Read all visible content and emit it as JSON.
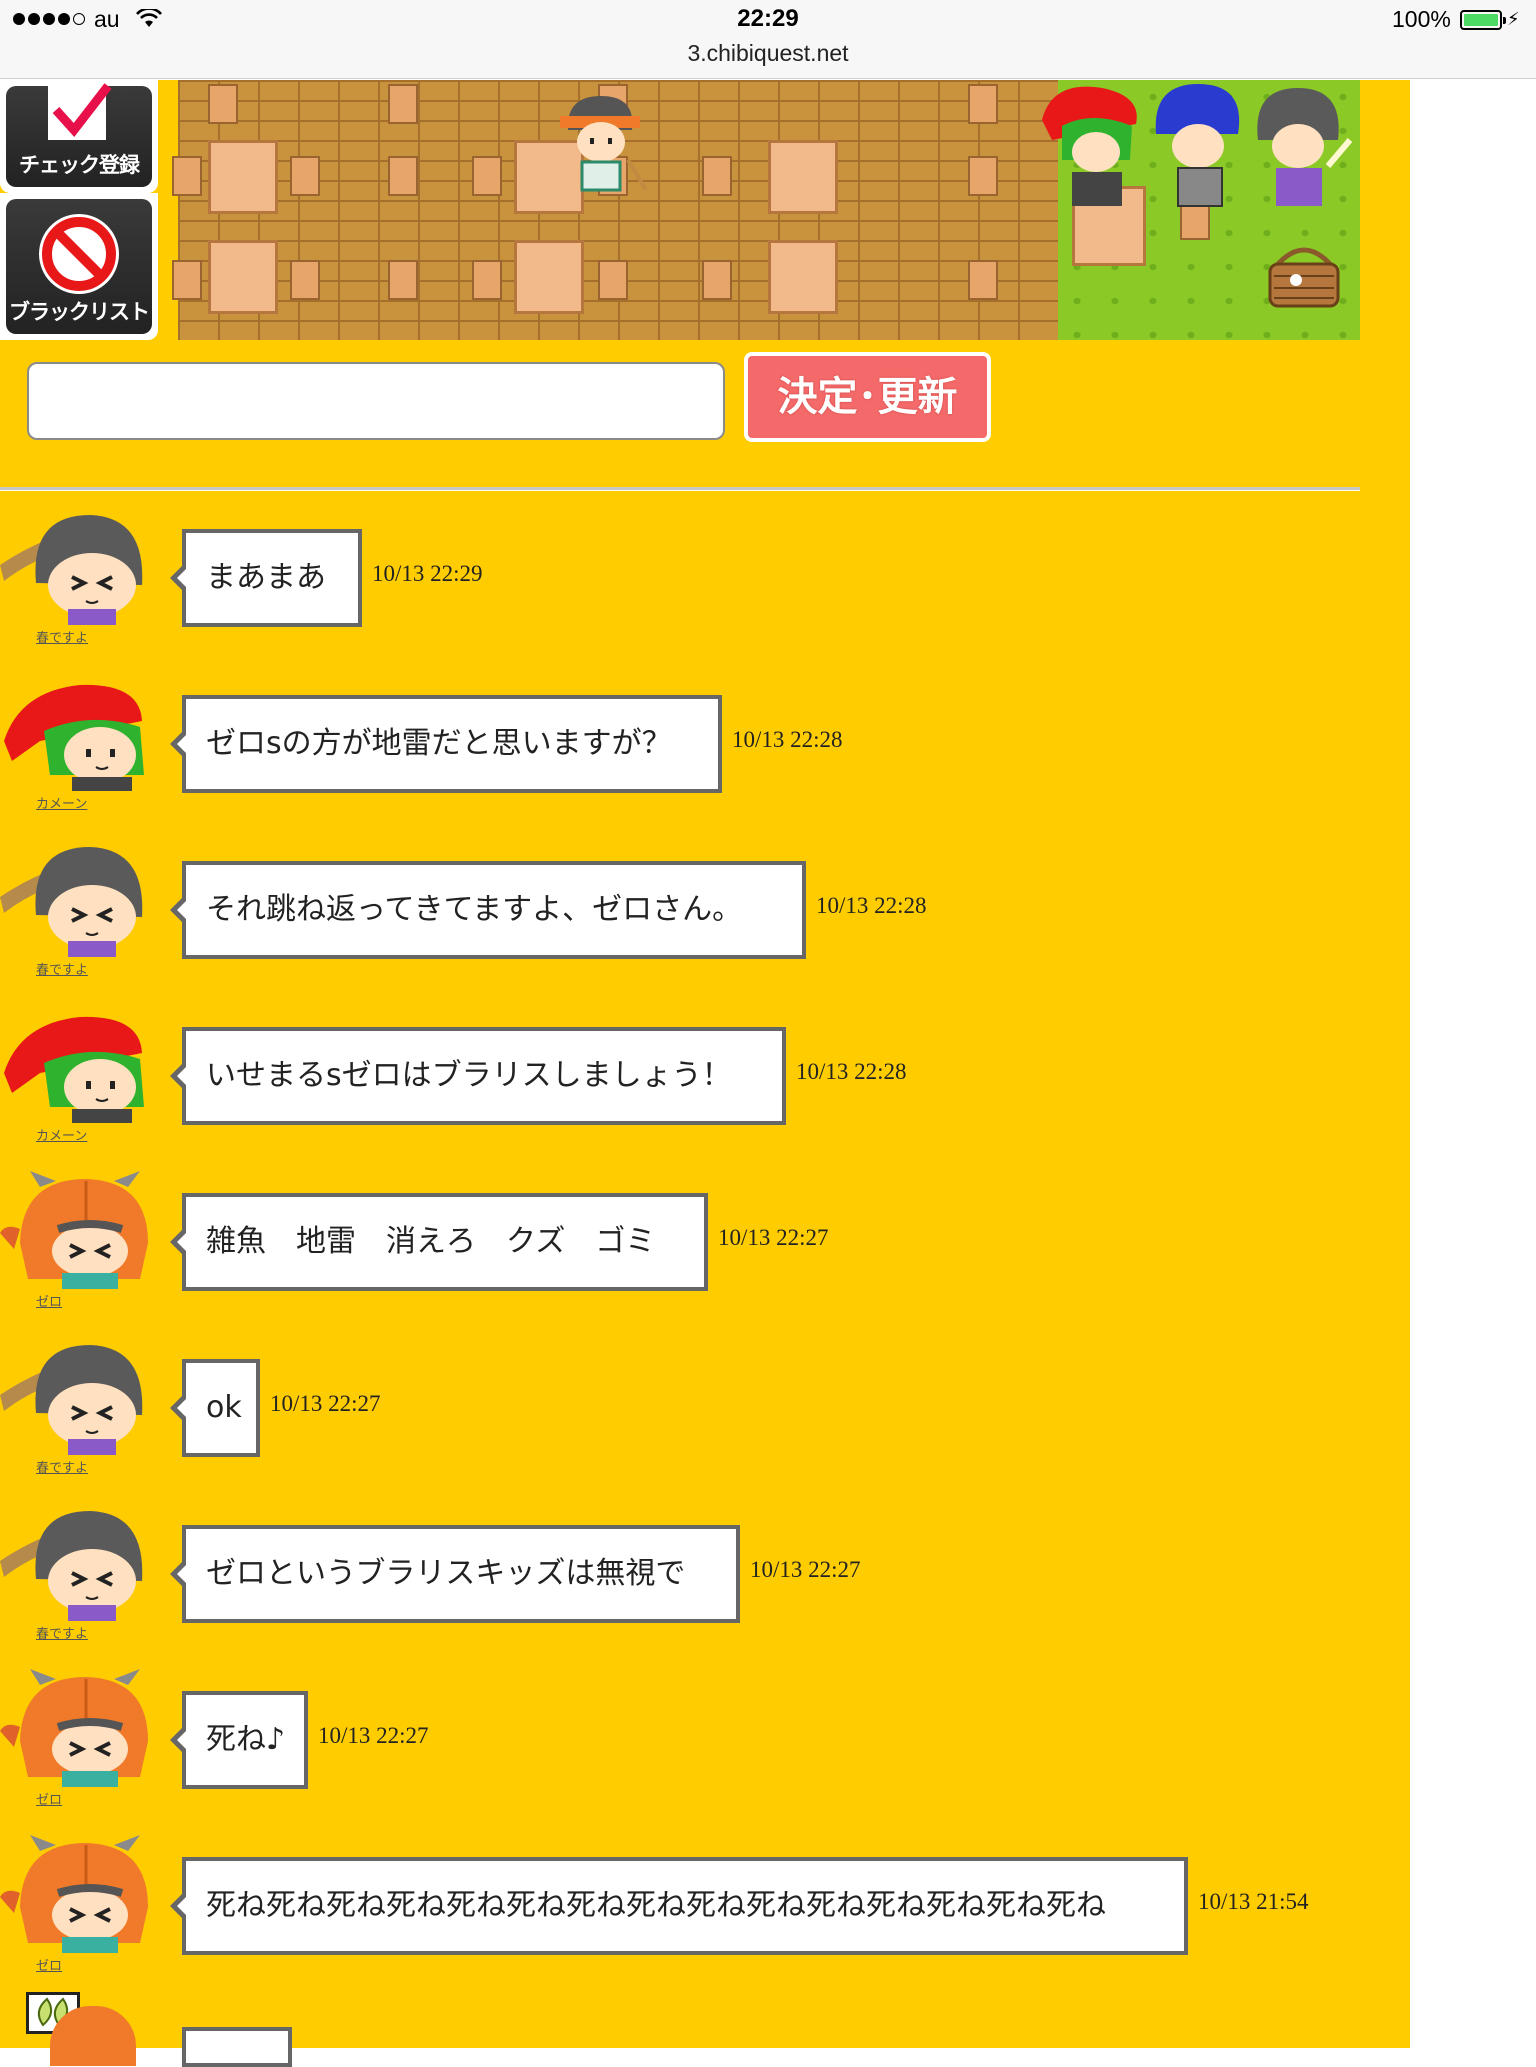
{
  "status_bar": {
    "carrier": "au",
    "time": "22:29",
    "url": "3.chibiquest.net",
    "battery_percent": "100%",
    "battery_level": 1.0,
    "signal_bars": 4
  },
  "side_buttons": {
    "check_label": "チェック登録",
    "blacklist_label": "ブラックリスト"
  },
  "input": {
    "value": "",
    "placeholder": ""
  },
  "submit_label": "決定･更新",
  "messages": [
    {
      "user": "春ですよ",
      "avatar": "gray-hair-avatar",
      "text": "まあまあ",
      "time": "10/13 22:29"
    },
    {
      "user": "カメーン",
      "avatar": "red-bandana-green-hair-avatar",
      "text": "ゼロsの方が地雷だと思いますが？",
      "time": "10/13 22:28"
    },
    {
      "user": "春ですよ",
      "avatar": "gray-hair-avatar",
      "text": "それ跳ね返ってきてますよ、ゼロさん。",
      "time": "10/13 22:28"
    },
    {
      "user": "カメーン",
      "avatar": "red-bandana-green-hair-avatar",
      "text": "いせまるsゼロはブラリスしましょう！",
      "time": "10/13 22:28"
    },
    {
      "user": "ゼロ",
      "avatar": "orange-horned-helmet-avatar",
      "text": "雑魚　地雷　消えろ　クズ　ゴミ",
      "time": "10/13 22:27"
    },
    {
      "user": "春ですよ",
      "avatar": "gray-hair-avatar",
      "text": "ok",
      "time": "10/13 22:27"
    },
    {
      "user": "春ですよ",
      "avatar": "gray-hair-avatar",
      "text": "ゼロというブラリスキッズは無視で",
      "time": "10/13 22:27"
    },
    {
      "user": "ゼロ",
      "avatar": "orange-horned-helmet-avatar",
      "text": "死ね♪",
      "time": "10/13 22:27"
    },
    {
      "user": "ゼロ",
      "avatar": "orange-horned-helmet-avatar",
      "text": "死ね死ね死ね死ね死ね死ね死ね死ね死ね死ね死ね死ね死ね死ね死ね",
      "time": "10/13 21:54"
    }
  ],
  "colors": {
    "page_background": "#ffcc00",
    "submit_button": "#f46a6a",
    "bubble_border": "#666666",
    "battery_fill": "#4cd964"
  }
}
